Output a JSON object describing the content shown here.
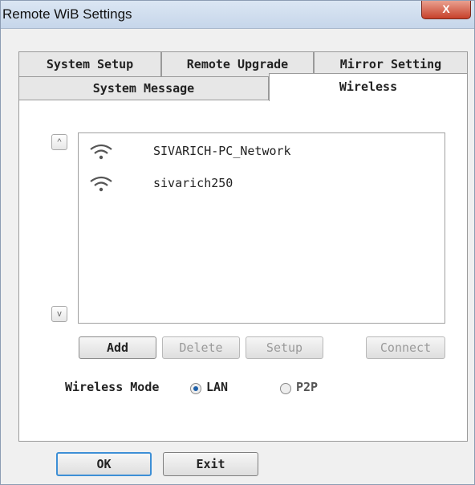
{
  "window": {
    "title": "Remote WiB Settings",
    "close_glyph": "X"
  },
  "tabs": {
    "row1": [
      "System Setup",
      "Remote Upgrade",
      "Mirror Setting"
    ],
    "row2": [
      "System Message",
      "Wireless"
    ],
    "active": "Wireless"
  },
  "scroll": {
    "up": "^",
    "down": "v"
  },
  "networks": [
    {
      "ssid": "SIVARICH-PC_Network",
      "icon": "wifi-icon"
    },
    {
      "ssid": "sivarich250",
      "icon": "wifi-icon"
    }
  ],
  "actions": {
    "add": "Add",
    "delete": "Delete",
    "setup": "Setup",
    "connect": "Connect"
  },
  "wireless_mode": {
    "label": "Wireless Mode",
    "options": [
      "LAN",
      "P2P"
    ],
    "selected": "LAN"
  },
  "footer": {
    "ok": "OK",
    "exit": "Exit"
  },
  "colors": {
    "accent": "#3d8fd6",
    "radio_selected": "#1d5fa8",
    "close_button": "#c7402a"
  }
}
